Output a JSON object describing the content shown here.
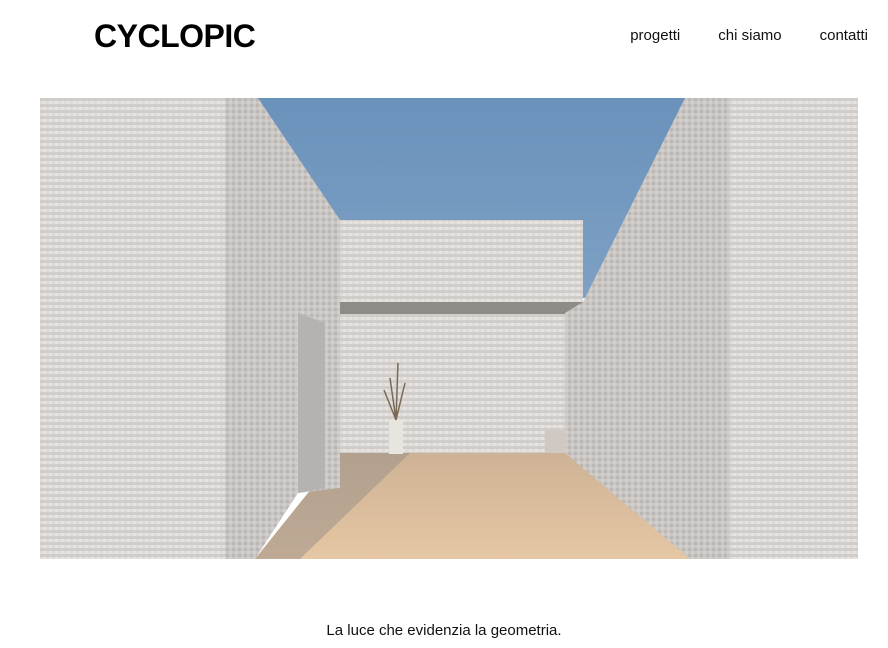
{
  "site": {
    "brand": "CYCLOPIC"
  },
  "nav": {
    "items": [
      {
        "label": "progetti"
      },
      {
        "label": "chi siamo"
      },
      {
        "label": "contatti"
      }
    ]
  },
  "hero": {
    "caption": "La luce che evidenzia la geometria."
  },
  "colors": {
    "sky": "#6b93bc",
    "floor": "#dcb894",
    "wall": "#d8d5d2"
  }
}
